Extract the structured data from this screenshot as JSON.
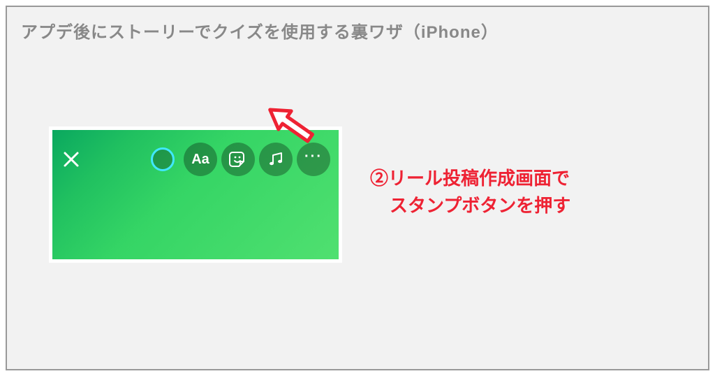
{
  "title": "アプデ後にストーリーでクイズを使用する裏ワザ（iPhone）",
  "caption": {
    "line1": "②リール投稿作成画面で",
    "line2": "スタンプボタンを押す"
  },
  "toolbar": {
    "text_label": "Aa"
  },
  "icons": {
    "close": "close-icon",
    "capture": "capture-ring-icon",
    "text": "text-icon",
    "sticker": "sticker-icon",
    "music": "music-icon",
    "more": "more-icon",
    "arrow": "annotation-arrow"
  },
  "colors": {
    "arrow_stroke": "#ee2233",
    "accent_text": "#ee2233",
    "frame_border": "#999999",
    "frame_bg": "#f2f2f2"
  }
}
